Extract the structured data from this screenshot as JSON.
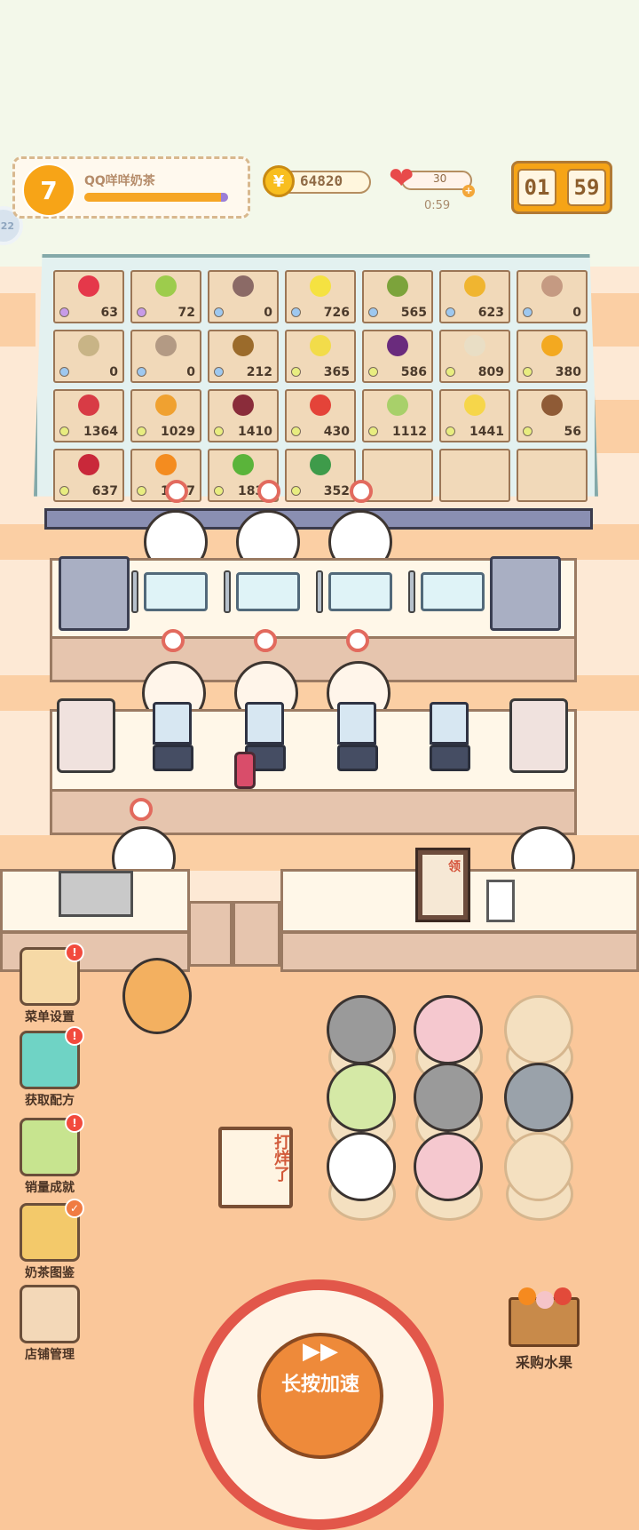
{
  "hud": {
    "level": "7",
    "shop_name": "QQ咩咩奶茶",
    "xp_progress": 0.96,
    "coins": "64820",
    "coin_symbol": "¥",
    "hearts": "30",
    "heart_timer": "0:59",
    "countdown_min": "01",
    "countdown_sec": "59",
    "side_badge": "22"
  },
  "fruits": [
    {
      "name": "strawberry",
      "qty": "63",
      "color": "#e5384a",
      "dot": "#c79be7"
    },
    {
      "name": "green-fruit",
      "qty": "72",
      "color": "#9dcc4c",
      "dot": "#c79be7"
    },
    {
      "name": "mangosteen",
      "qty": "0",
      "color": "#8b6a66",
      "dot": "#9ec8ef"
    },
    {
      "name": "lemon",
      "qty": "726",
      "color": "#f5e241",
      "dot": "#9ec8ef"
    },
    {
      "name": "avocado",
      "qty": "565",
      "color": "#7ca33b",
      "dot": "#9ec8ef"
    },
    {
      "name": "mango",
      "qty": "623",
      "color": "#f0b530",
      "dot": "#9ec8ef"
    },
    {
      "name": "lychee",
      "qty": "0",
      "color": "#c59a82",
      "dot": "#9ec8ef"
    },
    {
      "name": "durian",
      "qty": "0",
      "color": "#c8b486",
      "dot": "#9ec8ef"
    },
    {
      "name": "chestnut",
      "qty": "0",
      "color": "#b39a84",
      "dot": "#9ec8ef"
    },
    {
      "name": "kiwi",
      "qty": "212",
      "color": "#9b6b2b",
      "dot": "#9ec8ef"
    },
    {
      "name": "pear",
      "qty": "365",
      "color": "#f2dc4a",
      "dot": "#e8ed80"
    },
    {
      "name": "grape",
      "qty": "586",
      "color": "#6a2b7d",
      "dot": "#e8ed80"
    },
    {
      "name": "apple-core",
      "qty": "809",
      "color": "#e9dec5",
      "dot": "#e8ed80"
    },
    {
      "name": "pineapple",
      "qty": "380",
      "color": "#f3a920",
      "dot": "#e8ed80"
    },
    {
      "name": "pomegranate",
      "qty": "1364",
      "color": "#d83b45",
      "dot": "#e8ed80"
    },
    {
      "name": "papaya",
      "qty": "1029",
      "color": "#f0a130",
      "dot": "#e8ed80"
    },
    {
      "name": "passion-fruit",
      "qty": "1410",
      "color": "#8a2c3a",
      "dot": "#e8ed80"
    },
    {
      "name": "apple",
      "qty": "430",
      "color": "#e44339",
      "dot": "#e8ed80"
    },
    {
      "name": "guava",
      "qty": "1112",
      "color": "#a8d06a",
      "dot": "#e8ed80"
    },
    {
      "name": "banana",
      "qty": "1441",
      "color": "#f6d64a",
      "dot": "#e8ed80"
    },
    {
      "name": "coconut",
      "qty": "56",
      "color": "#8f5b36",
      "dot": "#e8ed80"
    },
    {
      "name": "cherry",
      "qty": "637",
      "color": "#c9283a",
      "dot": "#e8ed80"
    },
    {
      "name": "orange",
      "qty": "1287",
      "color": "#f48c1f",
      "dot": "#e8ed80"
    },
    {
      "name": "lime",
      "qty": "1833",
      "color": "#5ab43a",
      "dot": "#e8ed80"
    },
    {
      "name": "watermelon",
      "qty": "352",
      "color": "#3e9b4a",
      "dot": "#e8ed80"
    },
    {
      "name": "empty",
      "qty": "",
      "color": "transparent",
      "dot": "transparent"
    },
    {
      "name": "empty",
      "qty": "",
      "color": "transparent",
      "dot": "transparent"
    },
    {
      "name": "empty",
      "qty": "",
      "color": "transparent",
      "dot": "transparent"
    }
  ],
  "sidebar": [
    {
      "id": "menu-settings",
      "label": "菜单设置",
      "color": "#f6d9a6",
      "badge": "!"
    },
    {
      "id": "get-recipe",
      "label": "获取配方",
      "color": "#6fd3c5",
      "badge": "!"
    },
    {
      "id": "sales-achievement",
      "label": "销量成就",
      "color": "#c7e48f",
      "badge": "!"
    },
    {
      "id": "milk-tea-gallery",
      "label": "奶茶图鉴",
      "color": "#f3c96a",
      "badge": "✓"
    },
    {
      "id": "shop-management",
      "label": "店铺管理",
      "color": "#f3d8b8",
      "badge": ""
    }
  ],
  "sign": "打烊了",
  "poster": "领",
  "speed_button": {
    "arrows": "▶▶",
    "label": "长按加速"
  },
  "buy_fruit": {
    "label": "采购水果"
  },
  "customers": [
    {
      "id": "koala",
      "color": "#9a9a9a"
    },
    {
      "id": "pig",
      "color": "#f5c8cf"
    },
    {
      "id": "empty-bun",
      "color": "#f4e0c0"
    },
    {
      "id": "parrot",
      "color": "#d5e9a6"
    },
    {
      "id": "koala-2",
      "color": "#9a9a9a"
    },
    {
      "id": "cat",
      "color": "#9aa2aa"
    },
    {
      "id": "duck",
      "color": "#ffffff"
    },
    {
      "id": "pig-2",
      "color": "#f5c8cf"
    },
    {
      "id": "empty-bun-2",
      "color": "#f4e0c0"
    }
  ]
}
